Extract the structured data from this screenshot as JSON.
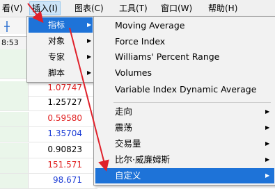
{
  "menubar": {
    "items": [
      {
        "label": "看(V)"
      },
      {
        "label": "插入(I)"
      },
      {
        "label": "图表(C)"
      },
      {
        "label": "工具(T)"
      },
      {
        "label": "窗口(W)"
      },
      {
        "label": "帮助(H)"
      }
    ]
  },
  "toolbar": {
    "time": "8:53"
  },
  "grid": {
    "values": [
      {
        "text": "",
        "color": "#000000"
      },
      {
        "text": "",
        "color": "#000000"
      },
      {
        "text": "1.07747",
        "color": "#e02020"
      },
      {
        "text": "1.25727",
        "color": "#000000"
      },
      {
        "text": "0.59580",
        "color": "#e02020"
      },
      {
        "text": "1.35704",
        "color": "#1f3fd6"
      },
      {
        "text": "0.90823",
        "color": "#000000"
      },
      {
        "text": "151.571",
        "color": "#e02020"
      },
      {
        "text": "98.671",
        "color": "#1f3fd6"
      }
    ]
  },
  "insert_menu": {
    "items": [
      {
        "label": "指标",
        "submenu": true,
        "selected": true
      },
      {
        "label": "对象",
        "submenu": true
      },
      {
        "label": "专家",
        "submenu": true
      },
      {
        "label": "脚本",
        "submenu": true
      }
    ]
  },
  "indicators_submenu": {
    "items": [
      {
        "label": "Moving Average"
      },
      {
        "label": "Force Index"
      },
      {
        "label": "Williams' Percent Range"
      },
      {
        "label": "Volumes"
      },
      {
        "label": "Variable Index Dynamic Average"
      }
    ],
    "groups": [
      {
        "label": "走向",
        "submenu": true
      },
      {
        "label": "震荡",
        "submenu": true
      },
      {
        "label": "交易量",
        "submenu": true
      },
      {
        "label": "比尔·威廉姆斯",
        "submenu": true
      },
      {
        "label": "自定义",
        "submenu": true,
        "selected": true
      }
    ]
  },
  "annotation_color": "#e0202a",
  "highlight_color": "#1e73d8"
}
